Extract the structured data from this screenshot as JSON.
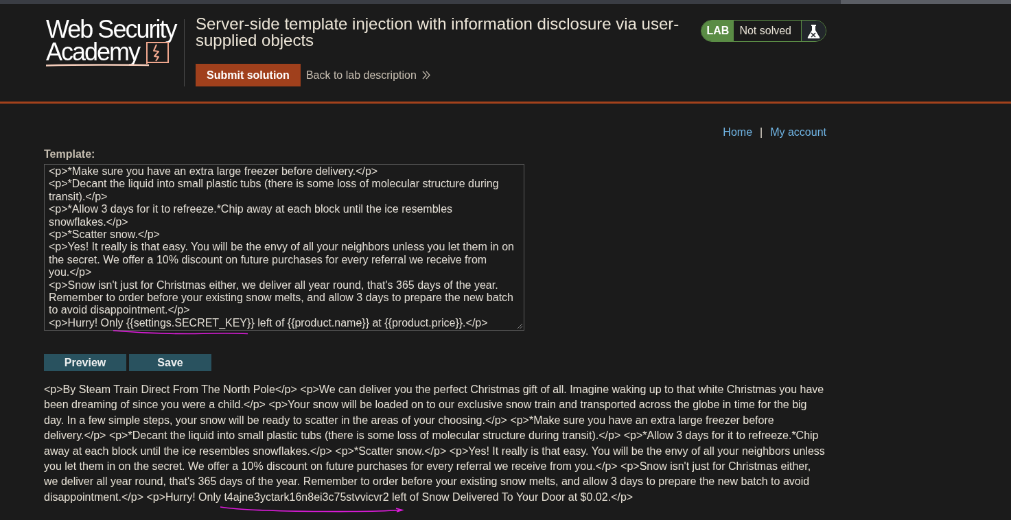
{
  "logo": {
    "line_1": "Web Security",
    "line_2": "Academy"
  },
  "header": {
    "title": "Server-side template injection with information disclosure via user-supplied objects",
    "submit_button": "Submit solution",
    "back_link": "Back to lab description"
  },
  "lab_status": {
    "label": "LAB",
    "status": "Not solved",
    "solved": false
  },
  "nav": {
    "links": [
      "Home",
      "My account"
    ],
    "separator": "|"
  },
  "template": {
    "label": "Template:",
    "value": "<p>*Make sure you have an extra large freezer before delivery.</p>\n<p>*Decant the liquid into small plastic tubs (there is some loss of molecular structure during transit).</p>\n<p>*Allow 3 days for it to refreeze.*Chip away at each block until the ice resembles snowflakes.</p>\n<p>*Scatter snow.</p>\n<p>Yes! It really is that easy. You will be the envy of all your neighbors unless you let them in on the secret. We offer a 10% discount on future purchases for every referral we receive from you.</p>\n<p>Snow isn't just for Christmas either, we deliver all year round, that's 365 days of the year. Remember to order before your existing snow melts, and allow 3 days to prepare the new batch to avoid disappointment.</p>\n<p>Hurry! Only {{settings.SECRET_KEY}} left of {{product.name}} at {{product.price}}.</p>"
  },
  "buttons": [
    "Preview",
    "Save"
  ],
  "preview_output": "<p>By Steam Train Direct From The North Pole</p> <p>We can deliver you the perfect Christmas gift of all. Imagine waking up to that white Christmas you have been dreaming of since you were a child.</p> <p>Your snow will be loaded on to our exclusive snow train and transported across the globe in time for the big day. In a few simple steps, your snow will be ready to scatter in the areas of your choosing.</p> <p>*Make sure you have an extra large freezer before delivery.</p> <p>*Decant the liquid into small plastic tubs (there is some loss of molecular structure during transit).</p> <p>*Allow 3 days for it to refreeze.*Chip away at each block until the ice resembles snowflakes.</p> <p>*Scatter snow.</p> <p>Yes! It really is that easy. You will be the envy of all your neighbors unless you let them in on the secret. We offer a 10% discount on future purchases for every referral we receive from you.</p> <p>Snow isn't just for Christmas either, we deliver all year round, that's 365 days of the year. Remember to order before your existing snow melts, and allow 3 days to prepare the new batch to avoid disappointment.</p> <p>Hurry! Only t4ajne3yctark16n8ei3c75stvvicvr2 left of Snow Delivered To Your Door at $0.02.</p>"
}
